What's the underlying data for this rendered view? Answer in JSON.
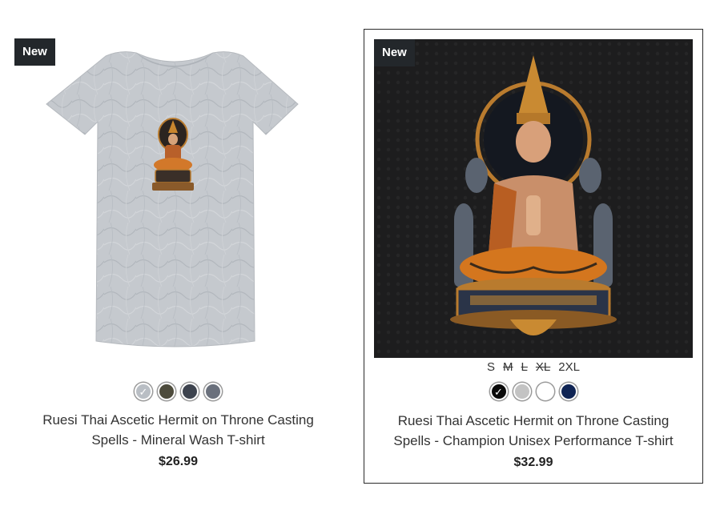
{
  "products": [
    {
      "badge": "New",
      "title_line1": "Ruesi Thai Ascetic Hermit on Throne Casting",
      "title_line2": "Spells - Mineral Wash T-shirt",
      "price": "$26.99",
      "swatches": [
        {
          "name": "light-grey",
          "color": "#b9bec4",
          "selected": true
        },
        {
          "name": "olive",
          "color": "#4d4b3c",
          "selected": false
        },
        {
          "name": "charcoal",
          "color": "#3d434e",
          "selected": false
        },
        {
          "name": "slate",
          "color": "#6a707c",
          "selected": false
        }
      ]
    },
    {
      "badge": "New",
      "sizes": [
        {
          "label": "S",
          "available": true
        },
        {
          "label": "M",
          "available": false
        },
        {
          "label": "L",
          "available": false
        },
        {
          "label": "XL",
          "available": false
        },
        {
          "label": "2XL",
          "available": true
        }
      ],
      "title_line1": "Ruesi Thai Ascetic Hermit on Throne Casting",
      "title_line2": "Spells - Champion Unisex Performance T-shirt",
      "price": "$32.99",
      "swatches": [
        {
          "name": "black",
          "color": "#0a0a0a",
          "selected": true
        },
        {
          "name": "silver",
          "color": "#c3c3c3",
          "selected": false
        },
        {
          "name": "white",
          "color": "#ffffff",
          "selected": false
        },
        {
          "name": "navy",
          "color": "#0f2454",
          "selected": false
        }
      ]
    }
  ],
  "icons": {
    "check": "checkmark-icon",
    "shirt": "tshirt-image",
    "artwork": "hermit-artwork-image"
  }
}
